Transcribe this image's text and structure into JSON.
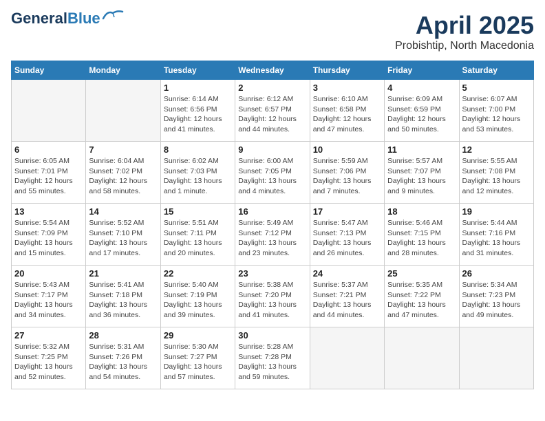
{
  "header": {
    "logo_line1": "General",
    "logo_line2": "Blue",
    "title": "April 2025",
    "subtitle": "Probishtip, North Macedonia"
  },
  "calendar": {
    "days_of_week": [
      "Sunday",
      "Monday",
      "Tuesday",
      "Wednesday",
      "Thursday",
      "Friday",
      "Saturday"
    ],
    "weeks": [
      [
        {
          "day": "",
          "info": ""
        },
        {
          "day": "",
          "info": ""
        },
        {
          "day": "1",
          "info": "Sunrise: 6:14 AM\nSunset: 6:56 PM\nDaylight: 12 hours and 41 minutes."
        },
        {
          "day": "2",
          "info": "Sunrise: 6:12 AM\nSunset: 6:57 PM\nDaylight: 12 hours and 44 minutes."
        },
        {
          "day": "3",
          "info": "Sunrise: 6:10 AM\nSunset: 6:58 PM\nDaylight: 12 hours and 47 minutes."
        },
        {
          "day": "4",
          "info": "Sunrise: 6:09 AM\nSunset: 6:59 PM\nDaylight: 12 hours and 50 minutes."
        },
        {
          "day": "5",
          "info": "Sunrise: 6:07 AM\nSunset: 7:00 PM\nDaylight: 12 hours and 53 minutes."
        }
      ],
      [
        {
          "day": "6",
          "info": "Sunrise: 6:05 AM\nSunset: 7:01 PM\nDaylight: 12 hours and 55 minutes."
        },
        {
          "day": "7",
          "info": "Sunrise: 6:04 AM\nSunset: 7:02 PM\nDaylight: 12 hours and 58 minutes."
        },
        {
          "day": "8",
          "info": "Sunrise: 6:02 AM\nSunset: 7:03 PM\nDaylight: 13 hours and 1 minute."
        },
        {
          "day": "9",
          "info": "Sunrise: 6:00 AM\nSunset: 7:05 PM\nDaylight: 13 hours and 4 minutes."
        },
        {
          "day": "10",
          "info": "Sunrise: 5:59 AM\nSunset: 7:06 PM\nDaylight: 13 hours and 7 minutes."
        },
        {
          "day": "11",
          "info": "Sunrise: 5:57 AM\nSunset: 7:07 PM\nDaylight: 13 hours and 9 minutes."
        },
        {
          "day": "12",
          "info": "Sunrise: 5:55 AM\nSunset: 7:08 PM\nDaylight: 13 hours and 12 minutes."
        }
      ],
      [
        {
          "day": "13",
          "info": "Sunrise: 5:54 AM\nSunset: 7:09 PM\nDaylight: 13 hours and 15 minutes."
        },
        {
          "day": "14",
          "info": "Sunrise: 5:52 AM\nSunset: 7:10 PM\nDaylight: 13 hours and 17 minutes."
        },
        {
          "day": "15",
          "info": "Sunrise: 5:51 AM\nSunset: 7:11 PM\nDaylight: 13 hours and 20 minutes."
        },
        {
          "day": "16",
          "info": "Sunrise: 5:49 AM\nSunset: 7:12 PM\nDaylight: 13 hours and 23 minutes."
        },
        {
          "day": "17",
          "info": "Sunrise: 5:47 AM\nSunset: 7:13 PM\nDaylight: 13 hours and 26 minutes."
        },
        {
          "day": "18",
          "info": "Sunrise: 5:46 AM\nSunset: 7:15 PM\nDaylight: 13 hours and 28 minutes."
        },
        {
          "day": "19",
          "info": "Sunrise: 5:44 AM\nSunset: 7:16 PM\nDaylight: 13 hours and 31 minutes."
        }
      ],
      [
        {
          "day": "20",
          "info": "Sunrise: 5:43 AM\nSunset: 7:17 PM\nDaylight: 13 hours and 34 minutes."
        },
        {
          "day": "21",
          "info": "Sunrise: 5:41 AM\nSunset: 7:18 PM\nDaylight: 13 hours and 36 minutes."
        },
        {
          "day": "22",
          "info": "Sunrise: 5:40 AM\nSunset: 7:19 PM\nDaylight: 13 hours and 39 minutes."
        },
        {
          "day": "23",
          "info": "Sunrise: 5:38 AM\nSunset: 7:20 PM\nDaylight: 13 hours and 41 minutes."
        },
        {
          "day": "24",
          "info": "Sunrise: 5:37 AM\nSunset: 7:21 PM\nDaylight: 13 hours and 44 minutes."
        },
        {
          "day": "25",
          "info": "Sunrise: 5:35 AM\nSunset: 7:22 PM\nDaylight: 13 hours and 47 minutes."
        },
        {
          "day": "26",
          "info": "Sunrise: 5:34 AM\nSunset: 7:23 PM\nDaylight: 13 hours and 49 minutes."
        }
      ],
      [
        {
          "day": "27",
          "info": "Sunrise: 5:32 AM\nSunset: 7:25 PM\nDaylight: 13 hours and 52 minutes."
        },
        {
          "day": "28",
          "info": "Sunrise: 5:31 AM\nSunset: 7:26 PM\nDaylight: 13 hours and 54 minutes."
        },
        {
          "day": "29",
          "info": "Sunrise: 5:30 AM\nSunset: 7:27 PM\nDaylight: 13 hours and 57 minutes."
        },
        {
          "day": "30",
          "info": "Sunrise: 5:28 AM\nSunset: 7:28 PM\nDaylight: 13 hours and 59 minutes."
        },
        {
          "day": "",
          "info": ""
        },
        {
          "day": "",
          "info": ""
        },
        {
          "day": "",
          "info": ""
        }
      ]
    ]
  }
}
